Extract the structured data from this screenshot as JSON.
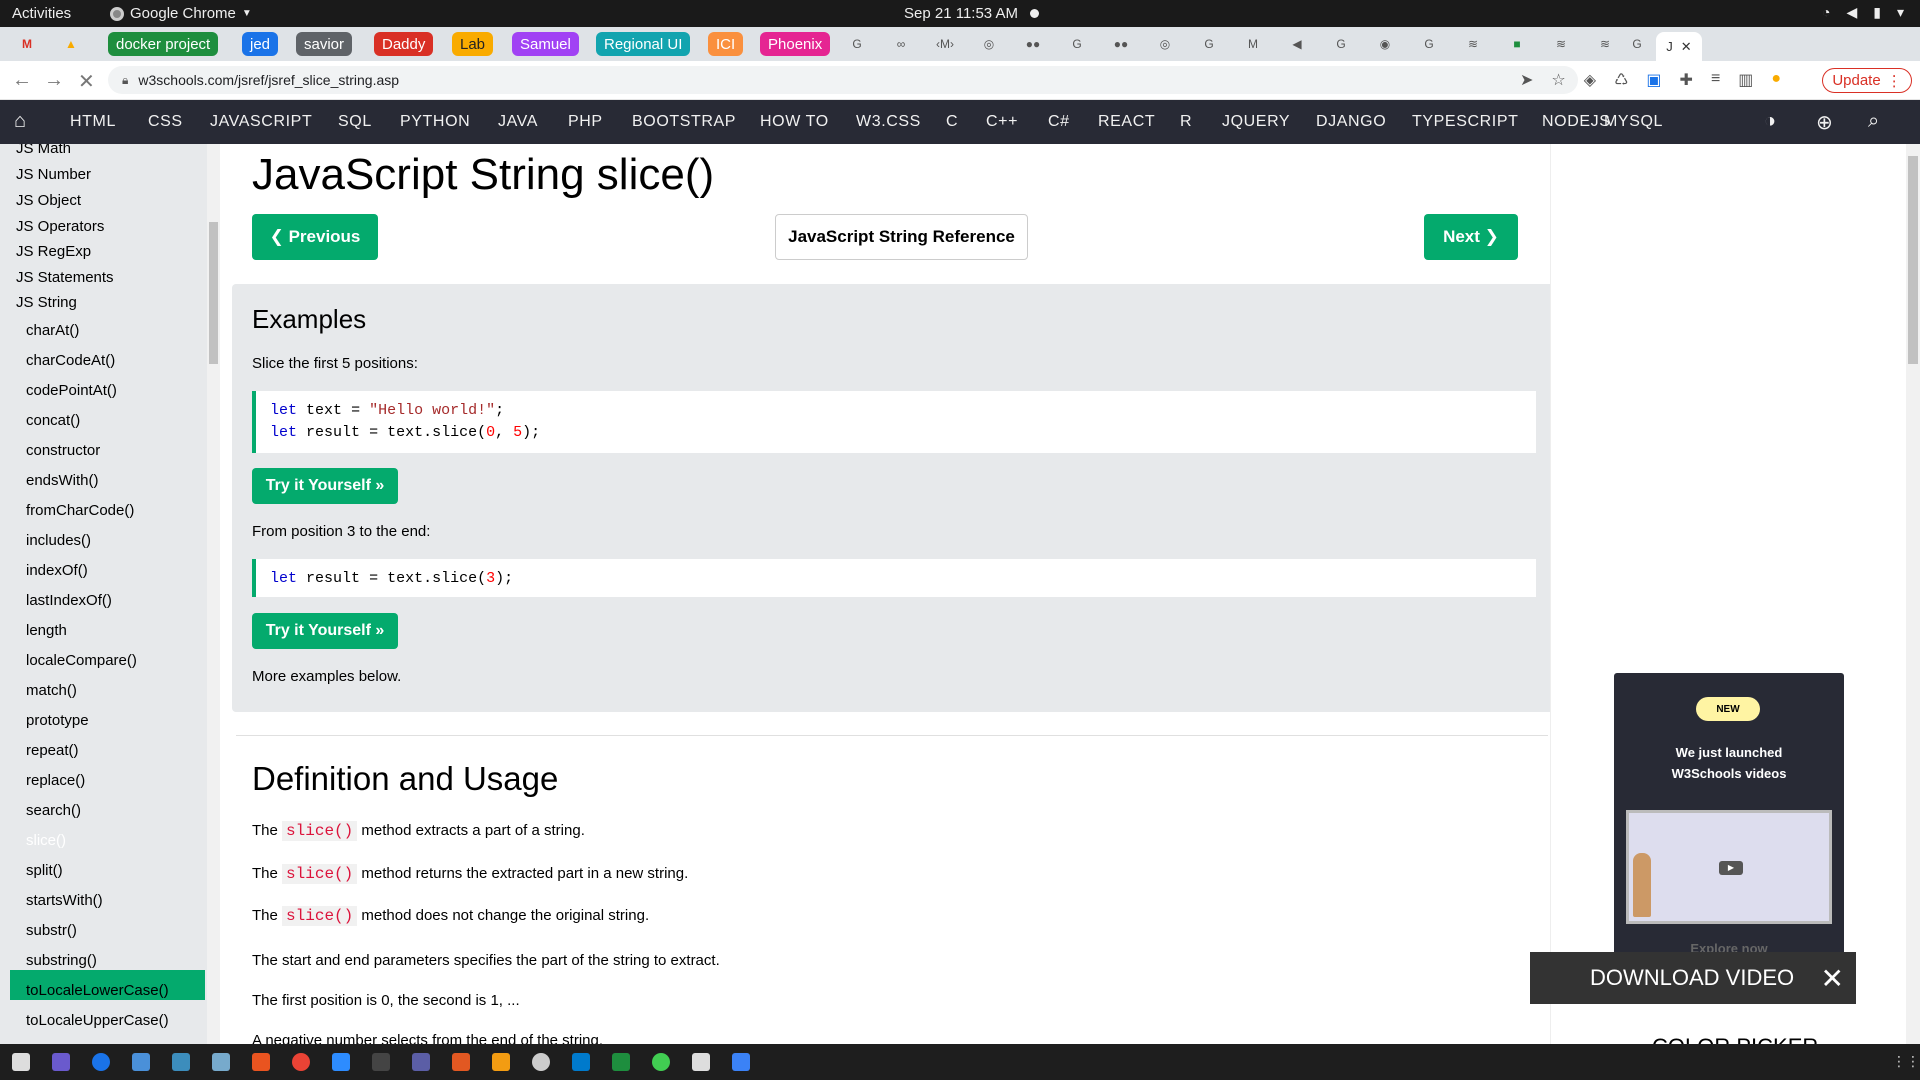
{
  "system": {
    "activities": "Activities",
    "app_name": "Google Chrome",
    "clock": "Sep 21  11:53 AM"
  },
  "tabs": {
    "groups": [
      {
        "label": "docker project",
        "color": "#1e8e3e"
      },
      {
        "label": "jed",
        "color": "#1a73e8"
      },
      {
        "label": "savior",
        "color": "#5f6368"
      },
      {
        "label": "Daddy",
        "color": "#d93025"
      },
      {
        "label": "Lab",
        "color": "#f9ab00"
      },
      {
        "label": "Samuel",
        "color": "#a142f4"
      },
      {
        "label": "Regional UI",
        "color": "#12a4af"
      },
      {
        "label": "ICI",
        "color": "#fa903e"
      },
      {
        "label": "Phoenix",
        "color": "#e52592"
      }
    ],
    "active_tab": "J"
  },
  "browser": {
    "url": "w3schools.com/jsref/jsref_slice_string.asp",
    "update_label": "Update"
  },
  "w3nav": {
    "items": [
      "HTML",
      "CSS",
      "JAVASCRIPT",
      "SQL",
      "PYTHON",
      "JAVA",
      "PHP",
      "BOOTSTRAP",
      "HOW TO",
      "W3.CSS",
      "C",
      "C++",
      "C#",
      "REACT",
      "R",
      "JQUERY",
      "DJANGO",
      "TYPESCRIPT",
      "NODEJS",
      "MYSQL"
    ]
  },
  "sidebar": {
    "top_items": [
      "JS Math",
      "JS Number",
      "JS Object",
      "JS Operators",
      "JS RegExp",
      "JS Statements",
      "JS String"
    ],
    "sub_items": [
      "charAt()",
      "charCodeAt()",
      "codePointAt()",
      "concat()",
      "constructor",
      "endsWith()",
      "fromCharCode()",
      "includes()",
      "indexOf()",
      "lastIndexOf()",
      "length",
      "localeCompare()",
      "match()",
      "prototype",
      "repeat()",
      "replace()",
      "search()",
      "slice()",
      "split()",
      "startsWith()",
      "substr()",
      "substring()",
      "toLocaleLowerCase()",
      "toLocaleUpperCase()"
    ],
    "active": "slice()"
  },
  "main": {
    "title": "JavaScript String slice()",
    "prev_label": "❮ Previous",
    "ref_label": "JavaScript String Reference",
    "next_label": "Next ❯",
    "examples_heading": "Examples",
    "ex1_desc": "Slice the first 5 positions:",
    "try_label": "Try it Yourself »",
    "ex2_desc": "From position 3 to the end:",
    "more_examples": "More examples below.",
    "def_heading": "Definition and Usage",
    "the": "The",
    "slice_code": "slice()",
    "def1_rest": "method extracts a part of a string.",
    "def2_rest": "method returns the extracted part in a new string.",
    "def3_rest": "method does not change the original string.",
    "def4": "The start and end parameters specifies the part of the string to extract.",
    "def5": "The first position is 0, the second is 1, ...",
    "def6": "A negative number selects from the end of the string."
  },
  "code": {
    "let": "let",
    "eq": "=",
    "semicolon": ";",
    "text_var": "text",
    "result_var": "result",
    "hello": "\"Hello world!\"",
    "slice_call": "text.slice(",
    "zero": "0",
    "comma": ", ",
    "five": "5",
    "three": "3",
    "close": ");"
  },
  "promo": {
    "badge": "NEW",
    "line1": "We just launched",
    "line2": "W3Schools videos",
    "explore": "Explore now"
  },
  "download": {
    "label": "DOWNLOAD VIDEO"
  },
  "colorpicker": "COLOR PICKER"
}
